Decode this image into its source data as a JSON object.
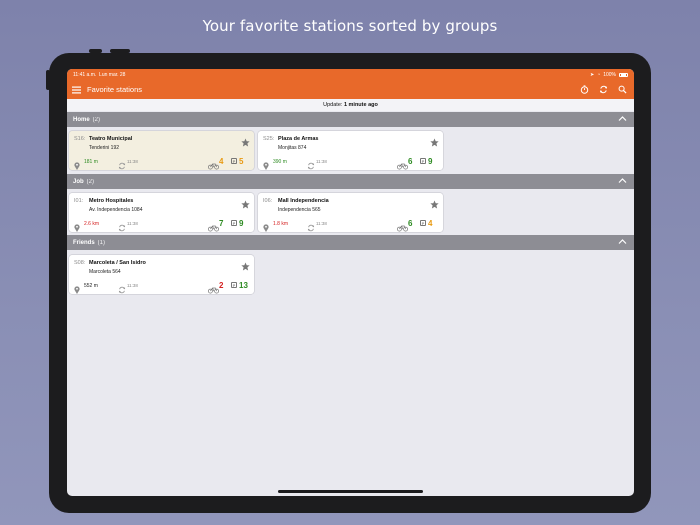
{
  "headline": "Your favorite stations sorted by groups",
  "status": {
    "time": "11:41 a.m.",
    "date": "Lun mar. 28",
    "battery": "100%"
  },
  "appbar": {
    "title": "Favorite stations"
  },
  "update": {
    "prefix": "Update:",
    "value": "1 minute ago"
  },
  "colors": {
    "accent": "#e8692a",
    "green": "#2e8b22",
    "orange": "#e89a12",
    "red": "#d42020"
  },
  "groups": [
    {
      "name": "Home",
      "count": "(2)"
    },
    {
      "name": "Job",
      "count": "(2)"
    },
    {
      "name": "Friends",
      "count": "(1)"
    }
  ],
  "stations": [
    {
      "code": "S16:",
      "name": "Teatro Municipal",
      "address": "Tenderini 192",
      "distance": "181 m",
      "time": "11:38",
      "bikes": "4",
      "docks": "5"
    },
    {
      "code": "S25:",
      "name": "Plaza de Armas",
      "address": "Monjitas 874",
      "distance": "390 m",
      "time": "11:38",
      "bikes": "6",
      "docks": "9"
    },
    {
      "code": "I01:",
      "name": "Metro Hospitales",
      "address": "Av. Independencia 1084",
      "distance": "2.6 km",
      "time": "11:38",
      "bikes": "7",
      "docks": "9"
    },
    {
      "code": "I06:",
      "name": "Mall Independencia",
      "address": "Independencia 565",
      "distance": "1.8 km",
      "time": "11:38",
      "bikes": "6",
      "docks": "4"
    },
    {
      "code": "S08:",
      "name": "Marcoleta / San Isidro",
      "address": "Marcoleta 564",
      "distance": "552 m",
      "time": "11:38",
      "bikes": "2",
      "docks": "13"
    }
  ],
  "icons": [
    "menu-icon",
    "timer-icon",
    "refresh-icon",
    "search-icon",
    "star-icon",
    "pin-icon",
    "sync-icon",
    "bike-icon",
    "parking-icon",
    "chevron-up-icon"
  ]
}
